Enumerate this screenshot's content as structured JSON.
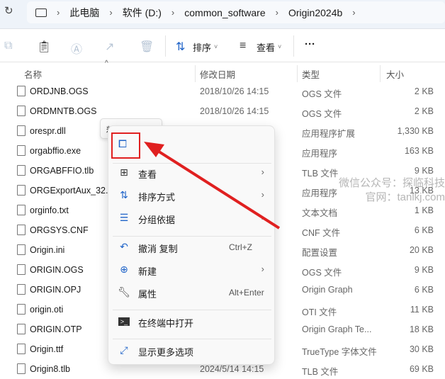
{
  "breadcrumb": [
    "此电脑",
    "软件 (D:)",
    "common_software",
    "Origin2024b"
  ],
  "toolbar": {
    "sort": "排序",
    "view": "查看",
    "more": "···"
  },
  "columns": {
    "name": "名称",
    "date": "修改日期",
    "type": "类型",
    "size": "大小"
  },
  "files": [
    {
      "name": "ORDJNB.OGS",
      "date": "2018/10/26 14:15",
      "type": "OGS 文件",
      "size": "2 KB"
    },
    {
      "name": "ORDMNTB.OGS",
      "date": "2018/10/26 14:15",
      "type": "OGS 文件",
      "size": "2 KB"
    },
    {
      "name": "orespr.dll",
      "date": "",
      "type": "应用程序扩展",
      "size": "1,330 KB"
    },
    {
      "name": "orgabffio.exe",
      "date": "",
      "type": "应用程序",
      "size": "163 KB"
    },
    {
      "name": "ORGABFFIO.tlb",
      "date": "",
      "type": "TLB 文件",
      "size": "9 KB"
    },
    {
      "name": "ORGExportAux_32.",
      "date": "",
      "type": "应用程序",
      "size": "13 KB"
    },
    {
      "name": "orginfo.txt",
      "date": "",
      "type": "文本文档",
      "size": "1 KB"
    },
    {
      "name": "ORGSYS.CNF",
      "date": "",
      "type": "CNF 文件",
      "size": "6 KB"
    },
    {
      "name": "Origin.ini",
      "date": "",
      "type": "配置设置",
      "size": "20 KB"
    },
    {
      "name": "ORIGIN.OGS",
      "date": "",
      "type": "OGS 文件",
      "size": "9 KB"
    },
    {
      "name": "ORIGIN.OPJ",
      "date": "",
      "type": "Origin Graph",
      "size": "6 KB"
    },
    {
      "name": "origin.oti",
      "date": "",
      "type": "OTI 文件",
      "size": "11 KB"
    },
    {
      "name": "ORIGIN.OTP",
      "date": "",
      "type": "Origin Graph Te...",
      "size": "18 KB"
    },
    {
      "name": "Origin.ttf",
      "date": "",
      "type": "TrueType 字体文件",
      "size": "30 KB"
    },
    {
      "name": "Origin8.tlb",
      "date": "2024/5/14 14:15",
      "type": "TLB 文件",
      "size": "69 KB"
    }
  ],
  "tooltip": "粘贴 (Ctrl+V)",
  "menu": {
    "view": "查看",
    "sort": "排序方式",
    "group": "分组依据",
    "undo": "撤消 复制",
    "undo_key": "Ctrl+Z",
    "new": "新建",
    "properties": "属性",
    "properties_key": "Alt+Enter",
    "terminal": "在终端中打开",
    "more": "显示更多选项"
  },
  "watermark": {
    "line1": "微信公众号：探临科技",
    "line2": "官网：tanlkj.com"
  }
}
